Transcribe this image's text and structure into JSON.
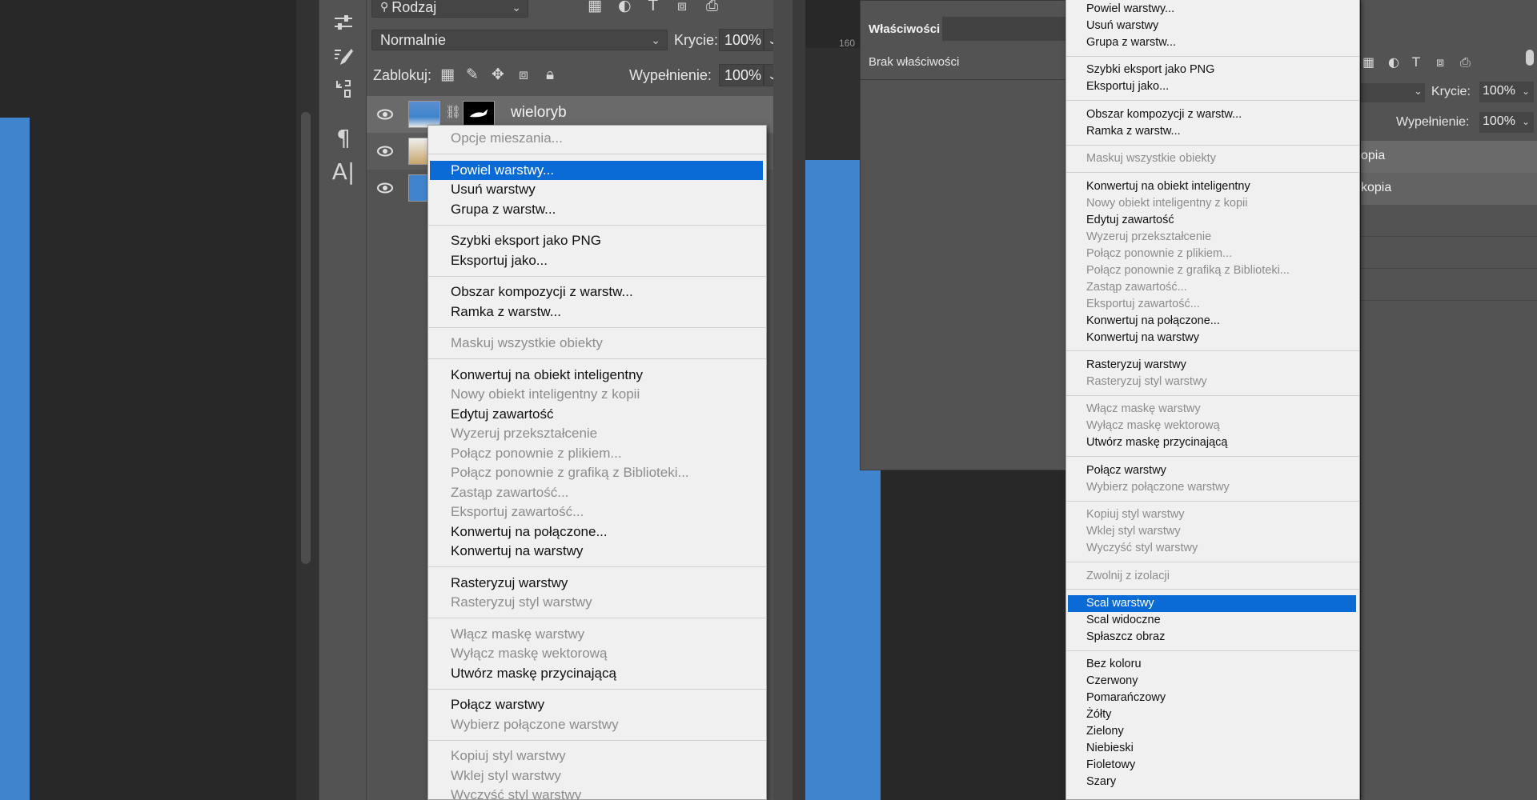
{
  "layers_panel": {
    "filter": {
      "label": "Rodzaj"
    },
    "blend_mode": "Normalnie",
    "opacity_label": "Krycie:",
    "opacity_value": "100%",
    "lock_label": "Zablokuj:",
    "fill_label": "Wypełnienie:",
    "fill_value": "100%",
    "layers": [
      {
        "name": "wieloryb"
      }
    ]
  },
  "properties_panel": {
    "tab": "Właściwości",
    "empty_text": "Brak właściwości",
    "ruler_mark": "160"
  },
  "context_menu_main": {
    "items": [
      {
        "label": "Opcje mieszania...",
        "state": "disabled"
      },
      {
        "label": "Powiel warstwy...",
        "state": "highlighted"
      },
      {
        "label": "Usuń warstwy",
        "state": "enabled"
      },
      {
        "label": "Grupa z warstw...",
        "state": "enabled"
      },
      {
        "label": "Szybki eksport jako PNG",
        "state": "enabled"
      },
      {
        "label": "Eksportuj jako...",
        "state": "enabled"
      },
      {
        "label": "Obszar kompozycji z warstw...",
        "state": "enabled"
      },
      {
        "label": "Ramka z warstw...",
        "state": "enabled"
      },
      {
        "label": "Maskuj wszystkie obiekty",
        "state": "disabled"
      },
      {
        "label": "Konwertuj na obiekt inteligentny",
        "state": "enabled"
      },
      {
        "label": "Nowy obiekt inteligentny z kopii",
        "state": "disabled"
      },
      {
        "label": "Edytuj zawartość",
        "state": "enabled"
      },
      {
        "label": "Wyzeruj przekształcenie",
        "state": "disabled"
      },
      {
        "label": "Połącz ponownie z plikiem...",
        "state": "disabled"
      },
      {
        "label": "Połącz ponownie z grafiką z Biblioteki...",
        "state": "disabled"
      },
      {
        "label": "Zastąp zawartość...",
        "state": "disabled"
      },
      {
        "label": "Eksportuj zawartość...",
        "state": "disabled"
      },
      {
        "label": "Konwertuj na połączone...",
        "state": "enabled"
      },
      {
        "label": "Konwertuj na warstwy",
        "state": "enabled"
      },
      {
        "label": "Rasteryzuj warstwy",
        "state": "enabled"
      },
      {
        "label": "Rasteryzuj styl warstwy",
        "state": "disabled"
      },
      {
        "label": "Włącz maskę warstwy",
        "state": "disabled"
      },
      {
        "label": "Wyłącz maskę wektorową",
        "state": "disabled"
      },
      {
        "label": "Utwórz maskę przycinającą",
        "state": "enabled"
      },
      {
        "label": "Połącz warstwy",
        "state": "enabled"
      },
      {
        "label": "Wybierz połączone warstwy",
        "state": "disabled"
      },
      {
        "label": "Kopiuj styl warstwy",
        "state": "disabled"
      },
      {
        "label": "Wklej styl warstwy",
        "state": "disabled"
      },
      {
        "label": "Wyczyść styl warstwy",
        "state": "disabled"
      }
    ]
  },
  "context_menu_right": {
    "items": [
      {
        "label": "Powiel warstwy...",
        "state": "enabled"
      },
      {
        "label": "Usuń warstwy",
        "state": "enabled"
      },
      {
        "label": "Grupa z warstw...",
        "state": "enabled"
      },
      {
        "label": "Szybki eksport jako PNG",
        "state": "enabled"
      },
      {
        "label": "Eksportuj jako...",
        "state": "enabled"
      },
      {
        "label": "Obszar kompozycji z warstw...",
        "state": "enabled"
      },
      {
        "label": "Ramka z warstw...",
        "state": "enabled"
      },
      {
        "label": "Maskuj wszystkie obiekty",
        "state": "disabled"
      },
      {
        "label": "Konwertuj na obiekt inteligentny",
        "state": "enabled"
      },
      {
        "label": "Nowy obiekt inteligentny z kopii",
        "state": "disabled"
      },
      {
        "label": "Edytuj zawartość",
        "state": "enabled"
      },
      {
        "label": "Wyzeruj przekształcenie",
        "state": "disabled"
      },
      {
        "label": "Połącz ponownie z plikiem...",
        "state": "disabled"
      },
      {
        "label": "Połącz ponownie z grafiką z Biblioteki...",
        "state": "disabled"
      },
      {
        "label": "Zastąp zawartość...",
        "state": "disabled"
      },
      {
        "label": "Eksportuj zawartość...",
        "state": "disabled"
      },
      {
        "label": "Konwertuj na połączone...",
        "state": "enabled"
      },
      {
        "label": "Konwertuj na warstwy",
        "state": "enabled"
      },
      {
        "label": "Rasteryzuj warstwy",
        "state": "enabled"
      },
      {
        "label": "Rasteryzuj styl warstwy",
        "state": "disabled"
      },
      {
        "label": "Włącz maskę warstwy",
        "state": "disabled"
      },
      {
        "label": "Wyłącz maskę wektorową",
        "state": "disabled"
      },
      {
        "label": "Utwórz maskę przycinającą",
        "state": "enabled"
      },
      {
        "label": "Połącz warstwy",
        "state": "enabled"
      },
      {
        "label": "Wybierz połączone warstwy",
        "state": "disabled"
      },
      {
        "label": "Kopiuj styl warstwy",
        "state": "disabled"
      },
      {
        "label": "Wklej styl warstwy",
        "state": "disabled"
      },
      {
        "label": "Wyczyść styl warstwy",
        "state": "disabled"
      },
      {
        "label": "Zwolnij z izolacji",
        "state": "disabled"
      },
      {
        "label": "Scal warstwy",
        "state": "highlighted"
      },
      {
        "label": "Scal widoczne",
        "state": "enabled"
      },
      {
        "label": "Spłaszcz obraz",
        "state": "enabled"
      },
      {
        "label": "Bez koloru",
        "state": "enabled"
      },
      {
        "label": "Czerwony",
        "state": "enabled"
      },
      {
        "label": "Pomarańczowy",
        "state": "enabled"
      },
      {
        "label": "Żółty",
        "state": "enabled"
      },
      {
        "label": "Zielony",
        "state": "enabled"
      },
      {
        "label": "Niebieski",
        "state": "enabled"
      },
      {
        "label": "Fioletowy",
        "state": "enabled"
      },
      {
        "label": "Szary",
        "state": "enabled"
      }
    ]
  },
  "right_layers_panel": {
    "opacity_label": "Krycie:",
    "opacity_value": "100%",
    "fill_label": "Wypełnienie:",
    "fill_value": "100%",
    "layer_1": "opia",
    "layer_2": "kopia"
  },
  "colors": {
    "highlight": "#0a6ad6",
    "canvas_blue": "#3f84cd",
    "panel": "#535353"
  }
}
